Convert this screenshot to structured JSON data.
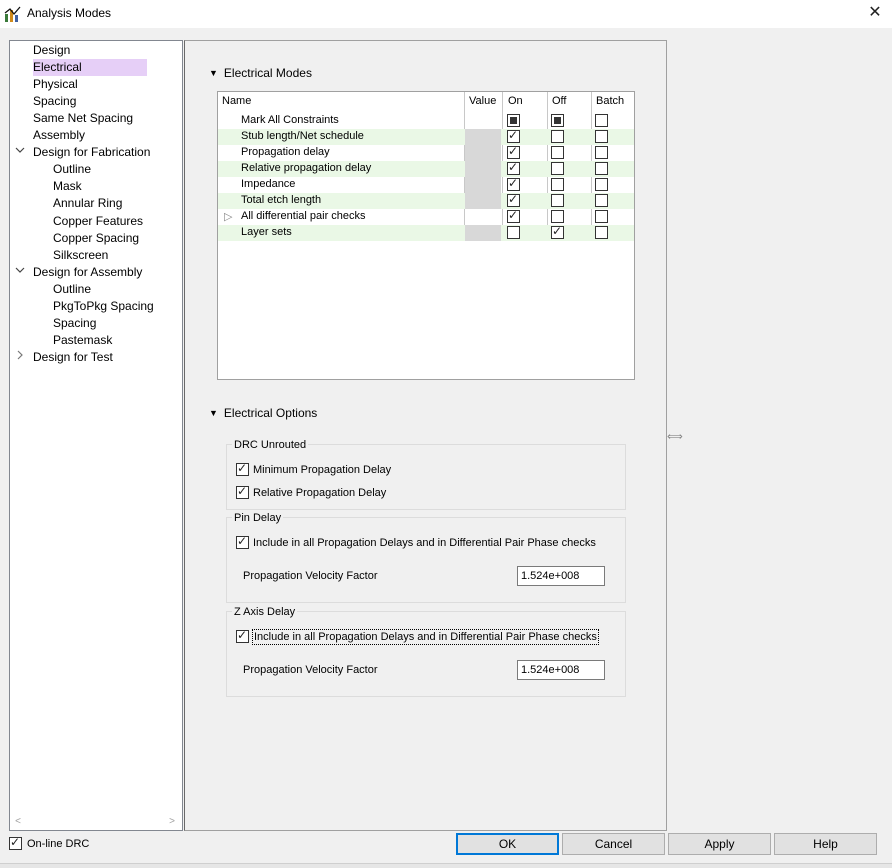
{
  "window": {
    "title": "Analysis Modes",
    "close_glyph": "✕",
    "icon": "analysis-chart-icon"
  },
  "nav": {
    "items": [
      {
        "label": "Design",
        "indent": 0,
        "chevron": ""
      },
      {
        "label": "Electrical",
        "indent": 0,
        "chevron": "",
        "selected": true
      },
      {
        "label": "Physical",
        "indent": 0,
        "chevron": ""
      },
      {
        "label": "Spacing",
        "indent": 0,
        "chevron": ""
      },
      {
        "label": "Same Net Spacing",
        "indent": 0,
        "chevron": ""
      },
      {
        "label": "Assembly",
        "indent": 0,
        "chevron": ""
      },
      {
        "label": "Design for Fabrication",
        "indent": 0,
        "chevron": "expanded"
      },
      {
        "label": "Outline",
        "indent": 1,
        "chevron": ""
      },
      {
        "label": "Mask",
        "indent": 1,
        "chevron": ""
      },
      {
        "label": "Annular Ring",
        "indent": 1,
        "chevron": ""
      },
      {
        "label": "Copper Features",
        "indent": 1,
        "chevron": ""
      },
      {
        "label": "Copper Spacing",
        "indent": 1,
        "chevron": ""
      },
      {
        "label": "Silkscreen",
        "indent": 1,
        "chevron": ""
      },
      {
        "label": "Design for Assembly",
        "indent": 0,
        "chevron": "expanded"
      },
      {
        "label": "Outline",
        "indent": 1,
        "chevron": ""
      },
      {
        "label": "PkgToPkg Spacing",
        "indent": 1,
        "chevron": ""
      },
      {
        "label": "Spacing",
        "indent": 1,
        "chevron": ""
      },
      {
        "label": "Pastemask",
        "indent": 1,
        "chevron": ""
      },
      {
        "label": "Design for Test",
        "indent": 0,
        "chevron": "collapsed"
      }
    ],
    "scroll_left": "<",
    "scroll_right": ">"
  },
  "electrical_modes": {
    "title": "Electrical Modes",
    "headers": {
      "name": "Name",
      "value": "Value",
      "on": "On",
      "off": "Off",
      "batch": "Batch"
    },
    "rows": [
      {
        "name": "Mark All Constraints",
        "on": "filled",
        "off": "filled",
        "batch": "empty",
        "value_white": true
      },
      {
        "name": "Stub length/Net schedule",
        "on": "checked",
        "off": "empty",
        "batch": "empty"
      },
      {
        "name": "Propagation delay",
        "on": "checked",
        "off": "empty",
        "batch": "empty"
      },
      {
        "name": "Relative propagation delay",
        "on": "checked",
        "off": "empty",
        "batch": "empty"
      },
      {
        "name": "Impedance",
        "on": "checked",
        "off": "empty",
        "batch": "empty"
      },
      {
        "name": "Total etch length",
        "on": "checked",
        "off": "empty",
        "batch": "empty"
      },
      {
        "name": "All differential pair checks",
        "on": "checked",
        "off": "empty",
        "batch": "empty",
        "value_white": true,
        "expander": "▷"
      },
      {
        "name": "Layer sets",
        "on": "empty",
        "off": "checked",
        "batch": "empty"
      }
    ]
  },
  "electrical_options": {
    "title": "Electrical Options",
    "drc_unrouted": {
      "label": "DRC Unrouted",
      "options": [
        {
          "label": "Minimum Propagation Delay",
          "checked": true
        },
        {
          "label": "Relative Propagation Delay",
          "checked": true
        }
      ]
    },
    "pin_delay": {
      "label": "Pin Delay",
      "include_label": "Include in all Propagation Delays and in Differential Pair Phase checks",
      "include_checked": true,
      "velocity_label": "Propagation Velocity Factor",
      "velocity_value": "1.524e+008"
    },
    "z_axis_delay": {
      "label": "Z Axis Delay",
      "include_label": "Include in all Propagation Delays and in Differential Pair Phase checks",
      "include_checked": true,
      "velocity_label": "Propagation Velocity Factor",
      "velocity_value": "1.524e+008"
    }
  },
  "footer": {
    "online_drc": {
      "label": "On-line DRC",
      "checked": true
    },
    "buttons": {
      "ok": "OK",
      "cancel": "Cancel",
      "apply": "Apply",
      "help": "Help"
    }
  },
  "glyphs": {
    "section_triangle": "▼",
    "splitter": "⟺"
  }
}
